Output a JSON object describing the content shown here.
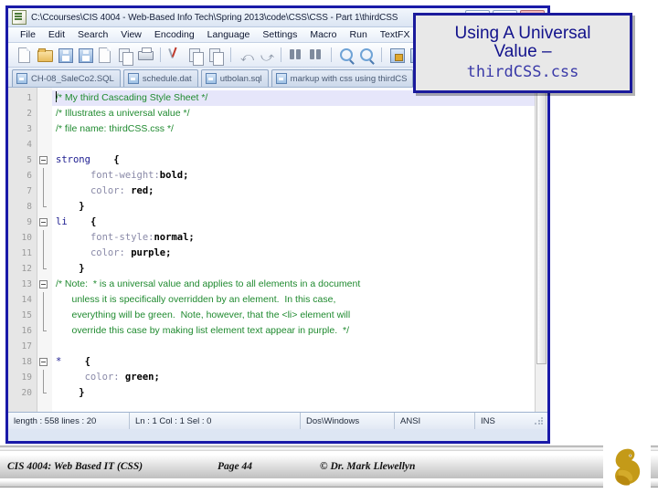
{
  "window": {
    "title": "C:\\Ccourses\\CIS 4004 - Web-Based Info Tech\\Spring 2013\\code\\CSS\\CSS - Part 1\\thirdCSS",
    "icon": "notepad-document-icon",
    "controls": {
      "minimize": "minimize-button",
      "maximize": "maximize-button",
      "close": "close-button"
    }
  },
  "menu": {
    "items": [
      "File",
      "Edit",
      "Search",
      "View",
      "Encoding",
      "Language",
      "Settings",
      "Macro",
      "Run",
      "TextFX"
    ]
  },
  "toolbar": {
    "icons": [
      "new-file-icon",
      "open-file-icon",
      "save-icon",
      "save-all-icon",
      "close-file-icon",
      "close-all-icon",
      "print-icon",
      "cut-icon",
      "copy-icon",
      "paste-icon",
      "undo-icon",
      "redo-icon",
      "find-icon",
      "replace-icon",
      "zoom-in-icon",
      "zoom-out-icon",
      "sync-vertical-icon",
      "sync-horizontal-icon"
    ]
  },
  "tabs": [
    {
      "label": "CH-08_SaleCo2.SQL",
      "active": false
    },
    {
      "label": "schedule.dat",
      "active": false
    },
    {
      "label": "utbolan.sql",
      "active": false
    },
    {
      "label": "markup with css using thirdCS",
      "active": true
    }
  ],
  "editor": {
    "lines": [
      {
        "n": "1",
        "fold": "none",
        "sel": true,
        "parts": [
          {
            "t": "comment",
            "s": "/* My third Cascading Style Sheet */"
          }
        ]
      },
      {
        "n": "2",
        "fold": "none",
        "parts": [
          {
            "t": "comment",
            "s": "/* Illustrates a universal value */"
          }
        ]
      },
      {
        "n": "3",
        "fold": "none",
        "parts": [
          {
            "t": "comment",
            "s": "/* file name: thirdCSS.css */"
          }
        ]
      },
      {
        "n": "4",
        "fold": "none",
        "parts": []
      },
      {
        "n": "5",
        "fold": "open",
        "parts": [
          {
            "t": "selector",
            "s": "strong"
          },
          {
            "t": "plain",
            "s": "    "
          },
          {
            "t": "brace",
            "s": "{"
          }
        ]
      },
      {
        "n": "6",
        "fold": "line",
        "parts": [
          {
            "t": "plain",
            "s": "      "
          },
          {
            "t": "prop",
            "s": "font-weight:"
          },
          {
            "t": "val",
            "s": "bold;"
          }
        ]
      },
      {
        "n": "7",
        "fold": "line",
        "parts": [
          {
            "t": "plain",
            "s": "      "
          },
          {
            "t": "prop",
            "s": "color: "
          },
          {
            "t": "val",
            "s": "red;"
          }
        ]
      },
      {
        "n": "8",
        "fold": "end",
        "parts": [
          {
            "t": "plain",
            "s": "    "
          },
          {
            "t": "brace",
            "s": "}"
          }
        ]
      },
      {
        "n": "9",
        "fold": "open",
        "parts": [
          {
            "t": "selector",
            "s": "li"
          },
          {
            "t": "plain",
            "s": "    "
          },
          {
            "t": "brace",
            "s": "{"
          }
        ]
      },
      {
        "n": "10",
        "fold": "line",
        "parts": [
          {
            "t": "plain",
            "s": "      "
          },
          {
            "t": "prop",
            "s": "font-style:"
          },
          {
            "t": "val",
            "s": "normal;"
          }
        ]
      },
      {
        "n": "11",
        "fold": "line",
        "parts": [
          {
            "t": "plain",
            "s": "      "
          },
          {
            "t": "prop",
            "s": "color: "
          },
          {
            "t": "val",
            "s": "purple;"
          }
        ]
      },
      {
        "n": "12",
        "fold": "end",
        "parts": [
          {
            "t": "plain",
            "s": "    "
          },
          {
            "t": "brace",
            "s": "}"
          }
        ]
      },
      {
        "n": "13",
        "fold": "open",
        "parts": [
          {
            "t": "comment",
            "s": "/* Note:  * is a universal value and applies to all elements in a document"
          }
        ]
      },
      {
        "n": "14",
        "fold": "line",
        "parts": [
          {
            "t": "comment",
            "s": "      unless it is specifically overridden by an element.  In this case,"
          }
        ]
      },
      {
        "n": "15",
        "fold": "line",
        "parts": [
          {
            "t": "comment",
            "s": "      everything will be green.  Note, however, that the <li> element will"
          }
        ]
      },
      {
        "n": "16",
        "fold": "end",
        "parts": [
          {
            "t": "comment",
            "s": "      override this case by making list element text appear in purple.  */"
          }
        ]
      },
      {
        "n": "17",
        "fold": "none",
        "parts": []
      },
      {
        "n": "18",
        "fold": "open",
        "parts": [
          {
            "t": "selector",
            "s": "*"
          },
          {
            "t": "plain",
            "s": "    "
          },
          {
            "t": "brace",
            "s": "{"
          }
        ]
      },
      {
        "n": "19",
        "fold": "line",
        "parts": [
          {
            "t": "plain",
            "s": "     "
          },
          {
            "t": "prop",
            "s": "color: "
          },
          {
            "t": "val",
            "s": "green;"
          }
        ]
      },
      {
        "n": "20",
        "fold": "end",
        "parts": [
          {
            "t": "plain",
            "s": "    "
          },
          {
            "t": "brace",
            "s": "}"
          }
        ]
      }
    ]
  },
  "statusbar": {
    "length_lines": "length : 558    lines : 20",
    "position": "Ln : 1    Col : 1    Sel : 0",
    "eol": "Dos\\Windows",
    "encoding": "ANSI",
    "insert_mode": "INS"
  },
  "callout": {
    "line1": "Using A Universal",
    "line2": "Value –",
    "line3": "thirdCSS.css",
    "border_color": "#1a1a9c",
    "text_color": "#12128c"
  },
  "footer": {
    "course": "CIS 4004: Web Based IT (CSS)",
    "page": "Page 44",
    "copyright": "© Dr. Mark Llewellyn",
    "logo": "ucf-pegasus-logo",
    "logo_color": "#c49a18"
  }
}
